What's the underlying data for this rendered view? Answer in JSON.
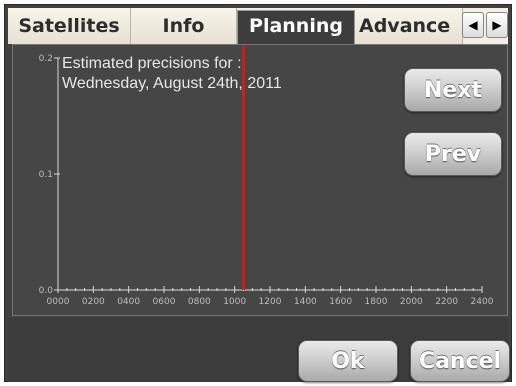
{
  "tabs": [
    {
      "label": "Satellites",
      "active": false
    },
    {
      "label": "Info",
      "active": false
    },
    {
      "label": "Planning",
      "active": true
    },
    {
      "label": "Advance",
      "active": false
    }
  ],
  "tab_scroll": {
    "left_icon": "triangle-left-icon",
    "right_icon": "triangle-right-icon"
  },
  "chart_title": "Estimated precisions for :\nWednesday, August 24th, 2011",
  "buttons": {
    "next": "Next",
    "prev": "Prev",
    "ok": "Ok",
    "cancel": "Cancel"
  },
  "colors": {
    "background": "#464646",
    "axis": "#d8d8d8",
    "marker": "#d11a1a",
    "button_text": "#ffffff"
  },
  "chart_data": {
    "type": "line",
    "title": "Estimated precisions for :\nWednesday, August 24th, 2011",
    "x_tick_labels": [
      "0000",
      "0200",
      "0400",
      "0600",
      "0800",
      "1000",
      "1200",
      "1400",
      "1600",
      "1800",
      "2000",
      "2200",
      "2400"
    ],
    "y_tick_labels": [
      "0.2",
      "0.1",
      "0.0"
    ],
    "ylim": [
      0.0,
      0.2
    ],
    "xlim": [
      "0000",
      "2400"
    ],
    "series": [],
    "marker_line": {
      "x": "1030",
      "color": "#d11a1a"
    },
    "grid": false
  }
}
